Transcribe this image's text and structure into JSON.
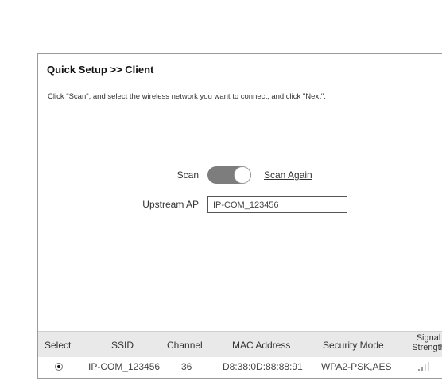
{
  "header": {
    "title": "Quick Setup >> Client"
  },
  "instructions": "Click \"Scan\", and select the wireless network you want to connect, and click \"Next\".",
  "scan": {
    "label": "Scan",
    "enabled": true,
    "scan_again_label": "Scan Again"
  },
  "upstream": {
    "label": "Upstream AP",
    "value": "IP-COM_123456"
  },
  "table": {
    "columns": {
      "select": "Select",
      "ssid": "SSID",
      "channel": "Channel",
      "mac": "MAC Address",
      "security": "Security Mode",
      "signal_line1": "Signal",
      "signal_line2": "Strength"
    },
    "rows": [
      {
        "selected": true,
        "ssid": "IP-COM_123456",
        "channel": "36",
        "mac": "D8:38:0D:88:88:91",
        "security": "WPA2-PSK,AES",
        "signal_bars": 4,
        "signal_bars_active": 2
      }
    ]
  },
  "colors": {
    "toggle_on": "#7d7d7d",
    "header_bg": "#e9e9e9",
    "border": "#9a9a9a"
  }
}
